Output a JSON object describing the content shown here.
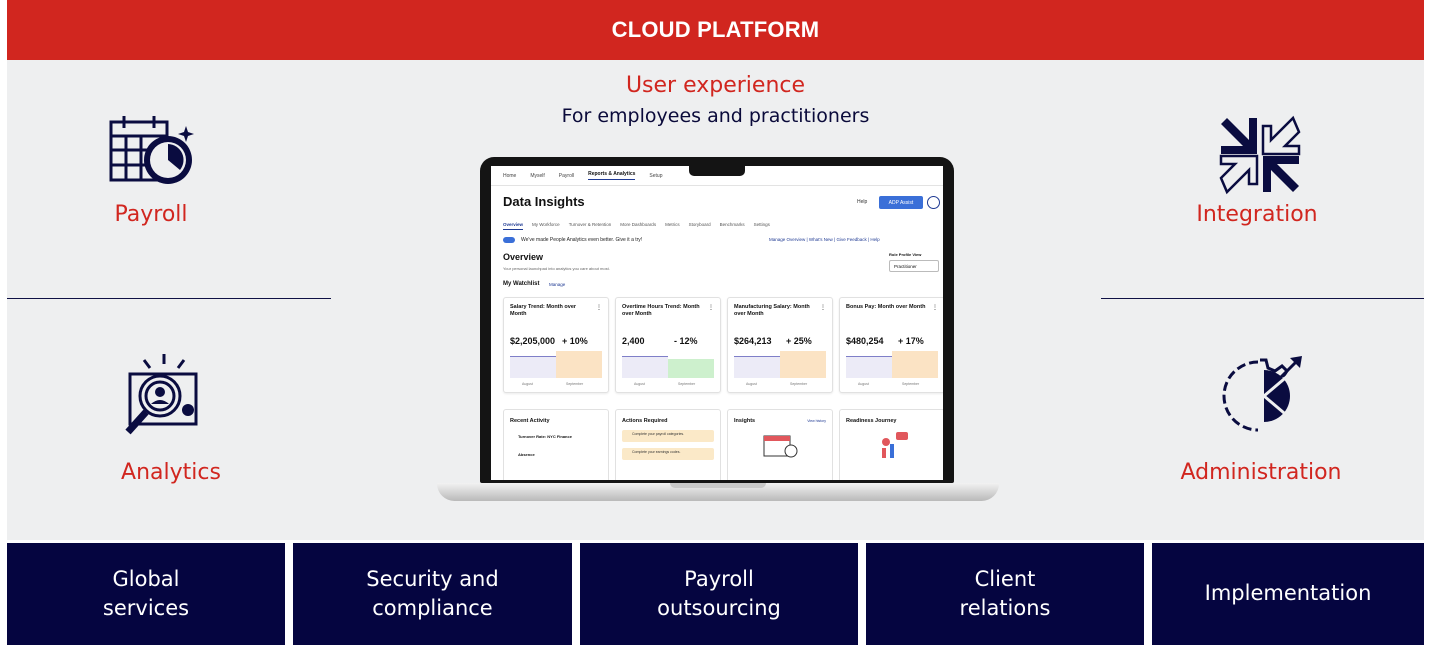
{
  "banner": "CLOUD PLATFORM",
  "user_experience": {
    "title": "User experience",
    "subtitle": "For employees and practitioners"
  },
  "features": {
    "payroll": {
      "label": "Payroll",
      "icon": "calendar-clock-icon"
    },
    "analytics": {
      "label": "Analytics",
      "icon": "magnifier-analytics-icon"
    },
    "integration": {
      "label": "Integration",
      "icon": "arrows-merge-icon"
    },
    "administration": {
      "label": "Administration",
      "icon": "gear-pie-icon"
    }
  },
  "services": [
    "Global\nservices",
    "Security and\ncompliance",
    "Payroll\noutsourcing",
    "Client\nrelations",
    "Implementation"
  ],
  "screen": {
    "nav": [
      "Home",
      "Myself",
      "Payroll",
      "Reports & Analytics",
      "Setup"
    ],
    "title": "Data Insights",
    "help": "Help",
    "assist": "ADP Assist",
    "tabs": [
      "Overview",
      "My Workforce",
      "Turnover & Retention",
      "More Dashboards",
      "Metrics",
      "Storyboard",
      "Benchmarks",
      "Settings"
    ],
    "promo": "We've made People Analytics even better. Give it a try!",
    "links": "Manage Overview  |  What's New  |  Give Feedback  |  Help",
    "overview_heading": "Overview",
    "overview_desc": "Your personal launchpad into analytics you care about most.",
    "role_label": "Role Profile View",
    "role_value": "Practitioner",
    "watchlist": "My Watchlist",
    "manage": "Manage",
    "cards": [
      {
        "title": "Salary Trend: Month over Month",
        "value": "$2,205,000",
        "change": "+ 10%",
        "current_color": "#fbe3c4",
        "current_level": 0.78
      },
      {
        "title": "Overtime Hours Trend: Month over Month",
        "value": "2,400",
        "change": "- 12%",
        "current_color": "#cdf0cd",
        "current_level": 0.55
      },
      {
        "title": "Manufacturing Salary: Month over Month",
        "value": "$264,213",
        "change": "+ 25%",
        "current_color": "#fbe3c4",
        "current_level": 0.8
      },
      {
        "title": "Bonus Pay: Month over Month",
        "value": "$480,254",
        "change": "+ 17%",
        "current_color": "#fbe3c4",
        "current_level": 0.8
      }
    ],
    "axis_prev": "August",
    "axis_cur": "September",
    "panels": {
      "recent_activity": "Recent Activity",
      "activity_items": [
        "Turnover Rate: NYC Finance",
        "Absence"
      ],
      "actions_required": "Actions Required",
      "action_items": [
        "Complete your payroll categories.",
        "Complete your earnings codes."
      ],
      "insights": "Insights",
      "view_history": "View history",
      "readiness": "Readiness Journey"
    }
  },
  "colors": {
    "red": "#d1261f",
    "navy": "#050540",
    "platform_bg": "#eeeff0"
  }
}
